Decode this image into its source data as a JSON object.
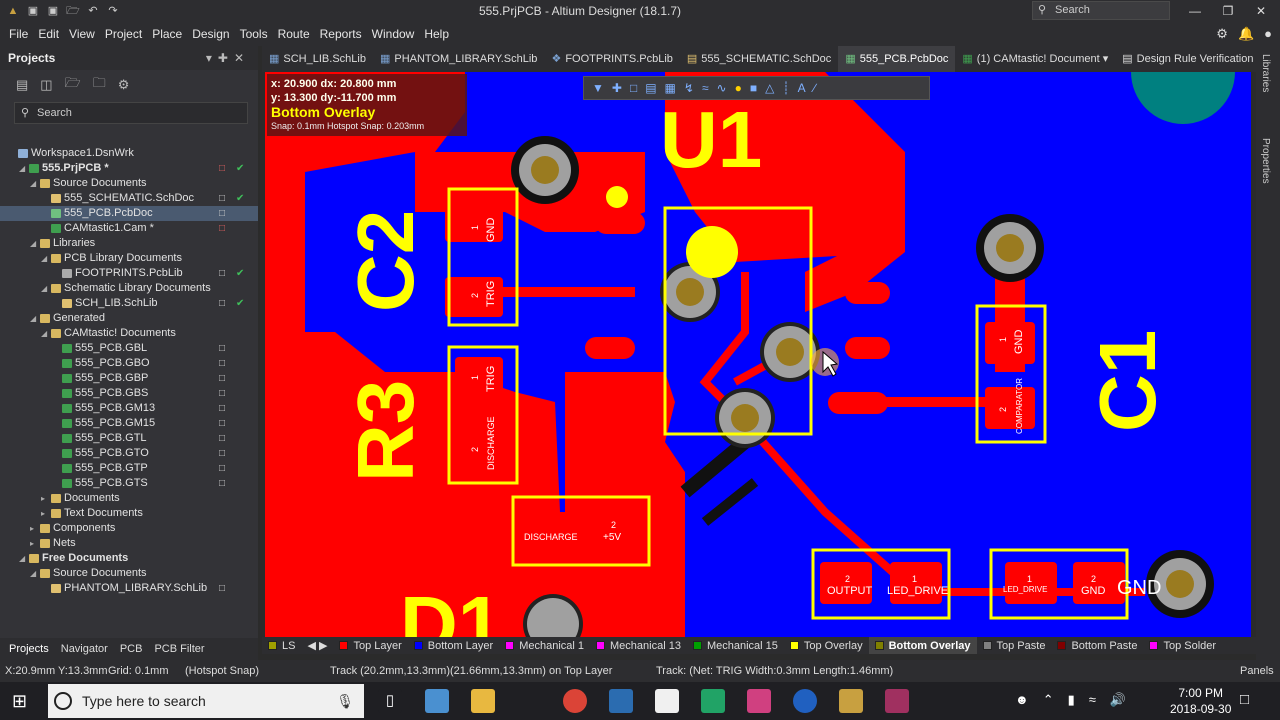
{
  "window": {
    "title": "555.PrjPCB - Altium Designer (18.1.7)",
    "search_placeholder": "Search",
    "min": "—",
    "max": "❐",
    "close": "✕"
  },
  "menu": [
    "File",
    "Edit",
    "View",
    "Project",
    "Place",
    "Design",
    "Tools",
    "Route",
    "Reports",
    "Window",
    "Help"
  ],
  "panel": {
    "title": "Projects",
    "search_placeholder": "Search",
    "tree": [
      {
        "label": "Workspace1.DsnWrk",
        "level": 0,
        "icon": "workspace-icon",
        "color": "#8fb0d8",
        "toggle": ""
      },
      {
        "label": "555.PrjPCB *",
        "level": 1,
        "icon": "project-icon",
        "color": "#3f9f4f",
        "toggle": "◢",
        "bold": true,
        "mark": "□",
        "mark_red": true,
        "check": "✔"
      },
      {
        "label": "Source Documents",
        "level": 2,
        "icon": "folder-icon",
        "color": "#d8b860",
        "toggle": "◢"
      },
      {
        "label": "555_SCHEMATIC.SchDoc",
        "level": 3,
        "icon": "schdoc-icon",
        "color": "#e0c070",
        "mark": "□",
        "check": "✔"
      },
      {
        "label": "555_PCB.PcbDoc",
        "level": 3,
        "icon": "pcbdoc-icon",
        "color": "#70c080",
        "mark": "□",
        "selected": true
      },
      {
        "label": "CAMtastic1.Cam *",
        "level": 3,
        "icon": "cam-icon",
        "color": "#3f9f4f",
        "mark": "□",
        "mark_red": true
      },
      {
        "label": "Libraries",
        "level": 2,
        "icon": "folder-icon",
        "color": "#d8b860",
        "toggle": "◢"
      },
      {
        "label": "PCB Library Documents",
        "level": 3,
        "icon": "folder-icon",
        "color": "#d8b860",
        "toggle": "◢"
      },
      {
        "label": "FOOTPRINTS.PcbLib",
        "level": 4,
        "icon": "pcblib-icon",
        "color": "#aaaaaa",
        "mark": "□",
        "check": "✔"
      },
      {
        "label": "Schematic Library Documents",
        "level": 3,
        "icon": "folder-icon",
        "color": "#d8b860",
        "toggle": "◢"
      },
      {
        "label": "SCH_LIB.SchLib",
        "level": 4,
        "icon": "schlib-icon",
        "color": "#e0c070",
        "mark": "□",
        "check": "✔"
      },
      {
        "label": "Generated",
        "level": 2,
        "icon": "folder-icon",
        "color": "#d8b860",
        "toggle": "◢"
      },
      {
        "label": "CAMtastic! Documents",
        "level": 3,
        "icon": "folder-icon",
        "color": "#d8b860",
        "toggle": "◢"
      },
      {
        "label": "555_PCB.GBL",
        "level": 4,
        "icon": "gerber-icon",
        "color": "#3f9f4f",
        "mark": "□"
      },
      {
        "label": "555_PCB.GBO",
        "level": 4,
        "icon": "gerber-icon",
        "color": "#3f9f4f",
        "mark": "□"
      },
      {
        "label": "555_PCB.GBP",
        "level": 4,
        "icon": "gerber-icon",
        "color": "#3f9f4f",
        "mark": "□"
      },
      {
        "label": "555_PCB.GBS",
        "level": 4,
        "icon": "gerber-icon",
        "color": "#3f9f4f",
        "mark": "□"
      },
      {
        "label": "555_PCB.GM13",
        "level": 4,
        "icon": "gerber-icon",
        "color": "#3f9f4f",
        "mark": "□"
      },
      {
        "label": "555_PCB.GM15",
        "level": 4,
        "icon": "gerber-icon",
        "color": "#3f9f4f",
        "mark": "□"
      },
      {
        "label": "555_PCB.GTL",
        "level": 4,
        "icon": "gerber-icon",
        "color": "#3f9f4f",
        "mark": "□"
      },
      {
        "label": "555_PCB.GTO",
        "level": 4,
        "icon": "gerber-icon",
        "color": "#3f9f4f",
        "mark": "□"
      },
      {
        "label": "555_PCB.GTP",
        "level": 4,
        "icon": "gerber-icon",
        "color": "#3f9f4f",
        "mark": "□"
      },
      {
        "label": "555_PCB.GTS",
        "level": 4,
        "icon": "gerber-icon",
        "color": "#3f9f4f",
        "mark": "□"
      },
      {
        "label": "Documents",
        "level": 3,
        "icon": "folder-icon",
        "color": "#d8b860",
        "toggle": "▸"
      },
      {
        "label": "Text Documents",
        "level": 3,
        "icon": "folder-icon",
        "color": "#d8b860",
        "toggle": "▸"
      },
      {
        "label": "Components",
        "level": 2,
        "icon": "folder-icon",
        "color": "#d8b860",
        "toggle": "▸"
      },
      {
        "label": "Nets",
        "level": 2,
        "icon": "folder-icon",
        "color": "#d8b860",
        "toggle": "▸"
      },
      {
        "label": "Free Documents",
        "level": 1,
        "icon": "folder-icon",
        "color": "#d8b860",
        "toggle": "◢",
        "bold": true
      },
      {
        "label": "Source Documents",
        "level": 2,
        "icon": "folder-icon",
        "color": "#d8b860",
        "toggle": "◢"
      },
      {
        "label": "PHANTOM_LIBRARY.SchLib",
        "level": 3,
        "icon": "schlib-icon",
        "color": "#e0c070",
        "mark": "□"
      }
    ],
    "tabs": [
      "Projects",
      "Navigator",
      "PCB",
      "PCB Filter"
    ]
  },
  "doc_tabs": [
    {
      "label": "SCH_LIB.SchLib"
    },
    {
      "label": "PHANTOM_LIBRARY.SchLib"
    },
    {
      "label": "FOOTPRINTS.PcbLib"
    },
    {
      "label": "555_SCHEMATIC.SchDoc"
    },
    {
      "label": "555_PCB.PcbDoc",
      "active": true
    },
    {
      "label": "(1) CAMtastic! Document ▾"
    },
    {
      "label": "Design Rule Verification Report"
    }
  ],
  "right_panels": [
    "Libraries",
    "Properties"
  ],
  "coord": {
    "line1": "x: 20.900   dx: 20.800 mm",
    "line2": "y: 13.300   dy:-11.700 mm",
    "layer": "Bottom Overlay",
    "snap": "Snap: 0.1mm Hotspot Snap: 0.203mm"
  },
  "pcb_labels": {
    "u1": "U1",
    "c2": "C2",
    "r3": "R3",
    "c1": "C1",
    "d1": "D1",
    "gnd": "GND",
    "trig": "TRIG",
    "discharge": "DISCHARGE",
    "plus5v": "+5V",
    "comparator": "COMPARATOR",
    "output": "OUTPUT",
    "led_drive": "LED_DRIVE",
    "led_drive_small": "LED_DRIVE",
    "gnd_big": "GND",
    "n1": "1",
    "n2": "2"
  },
  "layers": [
    {
      "label": "LS",
      "color": "#a0a000"
    },
    {
      "label": "Top Layer",
      "color": "#ff0000"
    },
    {
      "label": "Bottom Layer",
      "color": "#0000ff"
    },
    {
      "label": "Mechanical 1",
      "color": "#ff00ff"
    },
    {
      "label": "Mechanical 13",
      "color": "#ff00ff"
    },
    {
      "label": "Mechanical 15",
      "color": "#00a000"
    },
    {
      "label": "Top Overlay",
      "color": "#ffff00"
    },
    {
      "label": "Bottom Overlay",
      "color": "#808000",
      "active": true
    },
    {
      "label": "Top Paste",
      "color": "#808080"
    },
    {
      "label": "Bottom Paste",
      "color": "#800000"
    },
    {
      "label": "Top Solder",
      "color": "#ff00ff"
    }
  ],
  "status": {
    "pos": "X:20.9mm Y:13.3mm",
    "grid": "Grid: 0.1mm",
    "snap": "(Hotspot Snap)",
    "track1": "Track (20.2mm,13.3mm)(21.66mm,13.3mm) on Top Layer",
    "track2": "Track: (Net: TRIG Width:0.3mm Length:1.46mm)",
    "panels": "Panels"
  },
  "taskbar": {
    "search_placeholder": "Type here to search",
    "time": "7:00 PM",
    "date": "2018-09-30"
  }
}
